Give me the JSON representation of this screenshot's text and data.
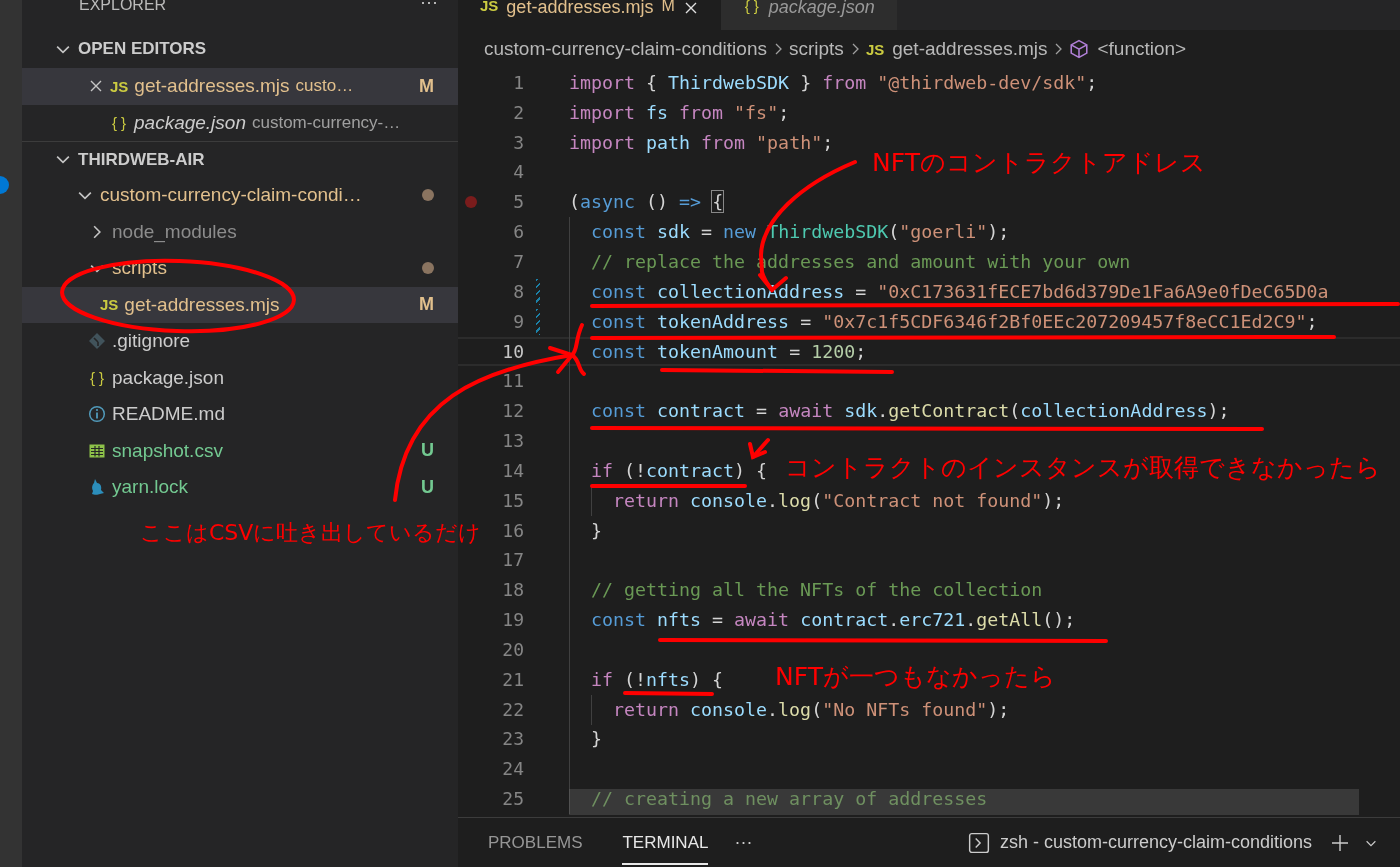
{
  "explorer": {
    "title": "EXPLORER",
    "more": "···",
    "open_editors": {
      "title": "OPEN EDITORS",
      "expanded": true,
      "items": [
        {
          "name": "get-addresses.mjs",
          "path": "custo…",
          "badge": "M",
          "kind": "js",
          "glyph": "JS",
          "modified": true,
          "selected": true,
          "preview": false
        },
        {
          "name": "package.json",
          "path": "custom-currency-…",
          "kind": "json",
          "glyph": "{ }",
          "modified": false,
          "selected": false,
          "preview": true
        }
      ]
    },
    "workspace": {
      "title": "THIRDWEB-AIR",
      "expanded": true,
      "tree": [
        {
          "name": "custom-currency-claim-condi…",
          "kind": "folder",
          "expanded": true,
          "modified": true,
          "untracked": false,
          "ignored": false,
          "dot": true,
          "selected": false,
          "children": [
            {
              "name": "node_modules",
              "kind": "folder",
              "expanded": false,
              "modified": false,
              "untracked": false,
              "ignored": true,
              "dot": false,
              "selected": false
            },
            {
              "name": "scripts",
              "kind": "folder",
              "expanded": true,
              "modified": true,
              "untracked": false,
              "ignored": false,
              "dot": true,
              "selected": false,
              "children": [
                {
                  "name": "get-addresses.mjs",
                  "kind": "js",
                  "glyph": "JS",
                  "modified": true,
                  "untracked": false,
                  "ignored": false,
                  "badge": "M",
                  "dot": false,
                  "selected": true
                }
              ]
            },
            {
              "name": ".gitignore",
              "kind": "git",
              "modified": false,
              "untracked": false,
              "ignored": false,
              "dot": false,
              "selected": false
            },
            {
              "name": "package.json",
              "kind": "json",
              "glyph": "{ }",
              "modified": false,
              "untracked": false,
              "ignored": false,
              "dot": false,
              "selected": false
            },
            {
              "name": "README.md",
              "kind": "info",
              "modified": false,
              "untracked": false,
              "ignored": false,
              "dot": false,
              "selected": false
            },
            {
              "name": "snapshot.csv",
              "kind": "table",
              "modified": false,
              "untracked": true,
              "ignored": false,
              "badge": "U",
              "dot": false,
              "selected": false
            },
            {
              "name": "yarn.lock",
              "kind": "yarn",
              "modified": false,
              "untracked": true,
              "ignored": false,
              "badge": "U",
              "dot": false,
              "selected": false
            }
          ]
        }
      ]
    }
  },
  "editor": {
    "tabs": [
      {
        "label": "get-addresses.mjs",
        "badge": "M",
        "kind": "js",
        "glyph": "JS",
        "selected": true,
        "preview": false
      },
      {
        "label": "package.json",
        "kind": "json",
        "glyph": "{ }",
        "selected": false,
        "preview": true
      }
    ],
    "breadcrumbs": [
      {
        "label": "custom-currency-claim-conditions",
        "kind": "folder"
      },
      {
        "label": "scripts",
        "kind": "folder"
      },
      {
        "label": "get-addresses.mjs",
        "kind": "js",
        "glyph": "JS"
      },
      {
        "label": "<function>",
        "kind": "symbol"
      }
    ],
    "lines": [
      {
        "n": "1",
        "current": false,
        "breakpoint": false,
        "changed": false,
        "in_block": false,
        "nested": false,
        "tokens": [
          {
            "t": "import ",
            "kind": "kw"
          },
          {
            "t": "{ ",
            "kind": "p"
          },
          {
            "t": "ThirdwebSDK ",
            "kind": "var"
          },
          {
            "t": "} ",
            "kind": "p"
          },
          {
            "t": "from ",
            "kind": "kw"
          },
          {
            "t": "\"@thirdweb-dev/sdk\"",
            "kind": "str"
          },
          {
            "t": ";",
            "kind": "p"
          }
        ]
      },
      {
        "n": "2",
        "current": false,
        "breakpoint": false,
        "changed": false,
        "in_block": false,
        "nested": false,
        "tokens": [
          {
            "t": "import ",
            "kind": "kw"
          },
          {
            "t": "fs ",
            "kind": "var"
          },
          {
            "t": "from ",
            "kind": "kw"
          },
          {
            "t": "\"fs\"",
            "kind": "str"
          },
          {
            "t": ";",
            "kind": "p"
          }
        ]
      },
      {
        "n": "3",
        "current": false,
        "breakpoint": false,
        "changed": false,
        "in_block": false,
        "nested": false,
        "tokens": [
          {
            "t": "import ",
            "kind": "kw"
          },
          {
            "t": "path ",
            "kind": "var"
          },
          {
            "t": "from ",
            "kind": "kw"
          },
          {
            "t": "\"path\"",
            "kind": "str"
          },
          {
            "t": ";",
            "kind": "p"
          }
        ]
      },
      {
        "n": "4",
        "current": false,
        "breakpoint": false,
        "changed": false,
        "in_block": false,
        "nested": false
      },
      {
        "n": "5",
        "current": false,
        "breakpoint": true,
        "changed": false,
        "in_block": false,
        "nested": false,
        "tokens": [
          {
            "t": "(",
            "kind": "p"
          },
          {
            "t": "async ",
            "kind": "st"
          },
          {
            "t": "() ",
            "kind": "p"
          },
          {
            "t": "=> ",
            "kind": "st"
          },
          {
            "t": "{",
            "kind": "match"
          }
        ]
      },
      {
        "n": "6",
        "current": false,
        "breakpoint": false,
        "changed": false,
        "in_block": true,
        "nested": false,
        "tokens": [
          {
            "t": "const ",
            "kind": "st"
          },
          {
            "t": "sdk ",
            "kind": "var"
          },
          {
            "t": "= ",
            "kind": "p"
          },
          {
            "t": "new ",
            "kind": "st"
          },
          {
            "t": "ThirdwebSDK",
            "kind": "cls"
          },
          {
            "t": "(",
            "kind": "p"
          },
          {
            "t": "\"goerli\"",
            "kind": "str"
          },
          {
            "t": ");",
            "kind": "p"
          }
        ]
      },
      {
        "n": "7",
        "current": false,
        "breakpoint": false,
        "changed": false,
        "in_block": true,
        "nested": false,
        "tokens": [
          {
            "t": "// replace the addresses and amount with your own",
            "kind": "cm"
          }
        ]
      },
      {
        "n": "8",
        "current": false,
        "breakpoint": false,
        "changed": true,
        "in_block": true,
        "nested": false,
        "tokens": [
          {
            "t": "const ",
            "kind": "st"
          },
          {
            "t": "collectionAddress ",
            "kind": "var"
          },
          {
            "t": "= ",
            "kind": "p"
          },
          {
            "t": "\"0xC173631fECE7bd6d379De1Fa6A9e0fDeC65D0a",
            "kind": "str"
          }
        ]
      },
      {
        "n": "9",
        "current": false,
        "breakpoint": false,
        "changed": true,
        "in_block": true,
        "nested": false,
        "tokens": [
          {
            "t": "const ",
            "kind": "st"
          },
          {
            "t": "tokenAddress ",
            "kind": "var"
          },
          {
            "t": "= ",
            "kind": "p"
          },
          {
            "t": "\"0x7c1f5CDF6346f2Bf0EEc207209457f8eCC1Ed2C9\"",
            "kind": "str"
          },
          {
            "t": ";",
            "kind": "p"
          }
        ]
      },
      {
        "n": "10",
        "current": true,
        "breakpoint": false,
        "changed": false,
        "in_block": true,
        "nested": false,
        "tokens": [
          {
            "t": "const ",
            "kind": "st"
          },
          {
            "t": "tokenAmount ",
            "kind": "var"
          },
          {
            "t": "= ",
            "kind": "p"
          },
          {
            "t": "1200",
            "kind": "num"
          },
          {
            "t": ";",
            "kind": "p"
          }
        ]
      },
      {
        "n": "11",
        "current": false,
        "breakpoint": false,
        "changed": false,
        "in_block": true,
        "nested": false
      },
      {
        "n": "12",
        "current": false,
        "breakpoint": false,
        "changed": false,
        "in_block": true,
        "nested": false,
        "tokens": [
          {
            "t": "const ",
            "kind": "st"
          },
          {
            "t": "contract ",
            "kind": "var"
          },
          {
            "t": "= ",
            "kind": "p"
          },
          {
            "t": "await ",
            "kind": "kw"
          },
          {
            "t": "sdk",
            "kind": "var"
          },
          {
            "t": ".",
            "kind": "p"
          },
          {
            "t": "getContract",
            "kind": "fn"
          },
          {
            "t": "(",
            "kind": "p"
          },
          {
            "t": "collectionAddress",
            "kind": "var"
          },
          {
            "t": ");",
            "kind": "p"
          }
        ]
      },
      {
        "n": "13",
        "current": false,
        "breakpoint": false,
        "changed": false,
        "in_block": true,
        "nested": false
      },
      {
        "n": "14",
        "current": false,
        "breakpoint": false,
        "changed": false,
        "in_block": true,
        "nested": false,
        "tokens": [
          {
            "t": "if ",
            "kind": "kw"
          },
          {
            "t": "(!",
            "kind": "p"
          },
          {
            "t": "contract",
            "kind": "var"
          },
          {
            "t": ") {",
            "kind": "p"
          }
        ]
      },
      {
        "n": "15",
        "current": false,
        "breakpoint": false,
        "changed": false,
        "in_block": true,
        "nested": true,
        "tokens": [
          {
            "t": "return ",
            "kind": "kw"
          },
          {
            "t": "console",
            "kind": "var"
          },
          {
            "t": ".",
            "kind": "p"
          },
          {
            "t": "log",
            "kind": "fn"
          },
          {
            "t": "(",
            "kind": "p"
          },
          {
            "t": "\"Contract not found\"",
            "kind": "str"
          },
          {
            "t": ");",
            "kind": "p"
          }
        ]
      },
      {
        "n": "16",
        "current": false,
        "breakpoint": false,
        "changed": false,
        "in_block": true,
        "nested": false,
        "tokens": [
          {
            "t": "}",
            "kind": "p"
          }
        ]
      },
      {
        "n": "17",
        "current": false,
        "breakpoint": false,
        "changed": false,
        "in_block": true,
        "nested": false
      },
      {
        "n": "18",
        "current": false,
        "breakpoint": false,
        "changed": false,
        "in_block": true,
        "nested": false,
        "tokens": [
          {
            "t": "// getting all the NFTs of the collection",
            "kind": "cm"
          }
        ]
      },
      {
        "n": "19",
        "current": false,
        "breakpoint": false,
        "changed": false,
        "in_block": true,
        "nested": false,
        "tokens": [
          {
            "t": "const ",
            "kind": "st"
          },
          {
            "t": "nfts ",
            "kind": "var"
          },
          {
            "t": "= ",
            "kind": "p"
          },
          {
            "t": "await ",
            "kind": "kw"
          },
          {
            "t": "contract",
            "kind": "var"
          },
          {
            "t": ".",
            "kind": "p"
          },
          {
            "t": "erc721",
            "kind": "var"
          },
          {
            "t": ".",
            "kind": "p"
          },
          {
            "t": "getAll",
            "kind": "fn"
          },
          {
            "t": "();",
            "kind": "p"
          }
        ]
      },
      {
        "n": "20",
        "current": false,
        "breakpoint": false,
        "changed": false,
        "in_block": true,
        "nested": false
      },
      {
        "n": "21",
        "current": false,
        "breakpoint": false,
        "changed": false,
        "in_block": true,
        "nested": false,
        "tokens": [
          {
            "t": "if ",
            "kind": "kw"
          },
          {
            "t": "(!",
            "kind": "p"
          },
          {
            "t": "nfts",
            "kind": "var"
          },
          {
            "t": ") {",
            "kind": "p"
          }
        ]
      },
      {
        "n": "22",
        "current": false,
        "breakpoint": false,
        "changed": false,
        "in_block": true,
        "nested": true,
        "tokens": [
          {
            "t": "return ",
            "kind": "kw"
          },
          {
            "t": "console",
            "kind": "var"
          },
          {
            "t": ".",
            "kind": "p"
          },
          {
            "t": "log",
            "kind": "fn"
          },
          {
            "t": "(",
            "kind": "p"
          },
          {
            "t": "\"No NFTs found\"",
            "kind": "str"
          },
          {
            "t": ");",
            "kind": "p"
          }
        ]
      },
      {
        "n": "23",
        "current": false,
        "breakpoint": false,
        "changed": false,
        "in_block": true,
        "nested": false,
        "tokens": [
          {
            "t": "}",
            "kind": "p"
          }
        ]
      },
      {
        "n": "24",
        "current": false,
        "breakpoint": false,
        "changed": false,
        "in_block": true,
        "nested": false
      },
      {
        "n": "25",
        "current": false,
        "breakpoint": false,
        "changed": false,
        "in_block": true,
        "nested": false,
        "tokens": [
          {
            "t": "// creating a new array of addresses",
            "kind": "cm"
          }
        ]
      }
    ]
  },
  "panel": {
    "tabs": [
      {
        "label": "PROBLEMS",
        "selected": false
      },
      {
        "label": "TERMINAL",
        "selected": true
      }
    ],
    "more": "···",
    "terminal": "zsh - custom-currency-claim-conditions"
  },
  "annotations": {
    "notes": [
      {
        "text": "NFTのコントラクトアドレス"
      },
      {
        "text": "コントラクトのインスタンスが取得できなかったら"
      },
      {
        "text": "ここはCSVに吐き出しているだけ"
      },
      {
        "text": "NFTが一つもなかったら"
      }
    ]
  }
}
